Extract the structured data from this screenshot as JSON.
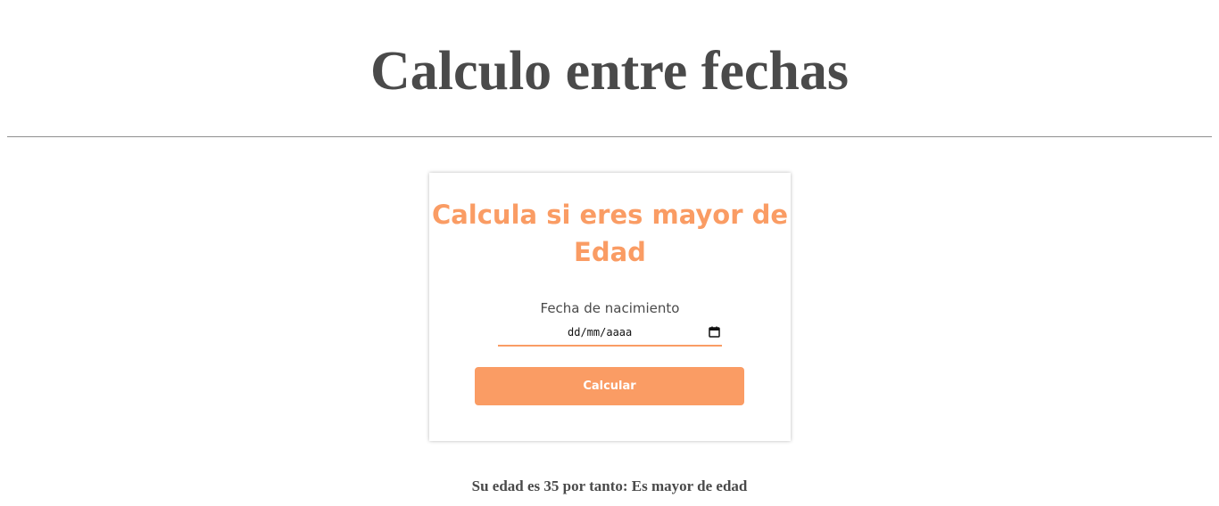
{
  "page": {
    "title": "Calculo entre fechas"
  },
  "card": {
    "title": "Calcula si eres mayor de Edad",
    "date_label": "Fecha de nacimiento",
    "date_placeholder": "dd/mm/aaaa",
    "calendar_icon": "calendar-icon",
    "button_label": "Calcular"
  },
  "result": {
    "text": "Su edad es 35 por tanto: Es mayor de edad"
  },
  "colors": {
    "accent": "#fa9c64",
    "text": "#4a4a4a",
    "divider": "#8f8f8f",
    "background": "#ffffff"
  }
}
